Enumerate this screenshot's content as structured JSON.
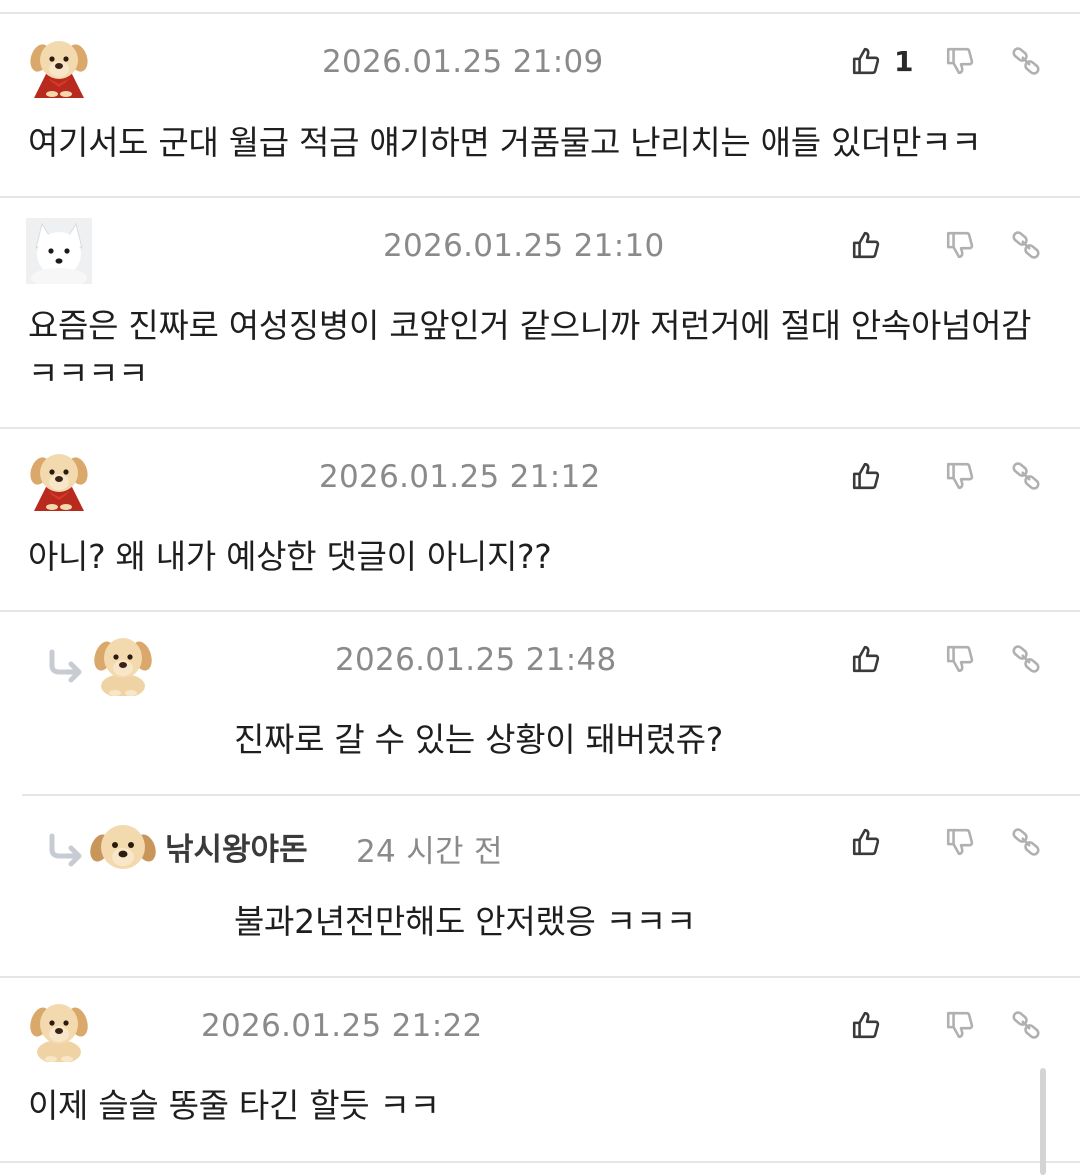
{
  "comments": [
    {
      "date": "2026.01.25 21:09",
      "likes": "1",
      "text": "여기서도 군대 월급 적금 얘기하면 거품물고 난리치는 애들 있더만ㅋㅋ",
      "avatar": "puppy-cape-icon"
    },
    {
      "date": "2026.01.25 21:10",
      "likes": "",
      "text": "요즘은 진짜로 여성징병이 코앞인거 같으니까 저런거에 절대 안속아넘어감 ㅋㅋㅋㅋ",
      "avatar": "white-fox-icon"
    },
    {
      "date": "2026.01.25 21:12",
      "likes": "",
      "text": "아니? 왜 내가 예상한 댓글이 아니지??",
      "avatar": "puppy-cape-icon"
    },
    {
      "date": "2026.01.25 21:48",
      "likes": "",
      "text": "진짜로 갈 수 있는 상황이 돼버렸쥬?",
      "avatar": "puppy-icon",
      "is_reply": true
    },
    {
      "nickname": "낚시왕야돈",
      "date": "24 시간 전",
      "likes": "",
      "text": "불과2년전만해도 안저랬응 ㅋㅋㅋ",
      "avatar": "puppy-face-icon",
      "is_reply": true
    },
    {
      "date": "2026.01.25 21:22",
      "likes": "",
      "text": "이제 슬슬 똥줄 타긴 할듯 ㅋㅋ",
      "avatar": "puppy-icon"
    }
  ],
  "colors": {
    "text": "#1e1e1e",
    "meta": "#8a8a8a",
    "divider": "#e6e6e6",
    "icon": "#3a3a3a",
    "icon_muted": "#b0b0b0"
  }
}
